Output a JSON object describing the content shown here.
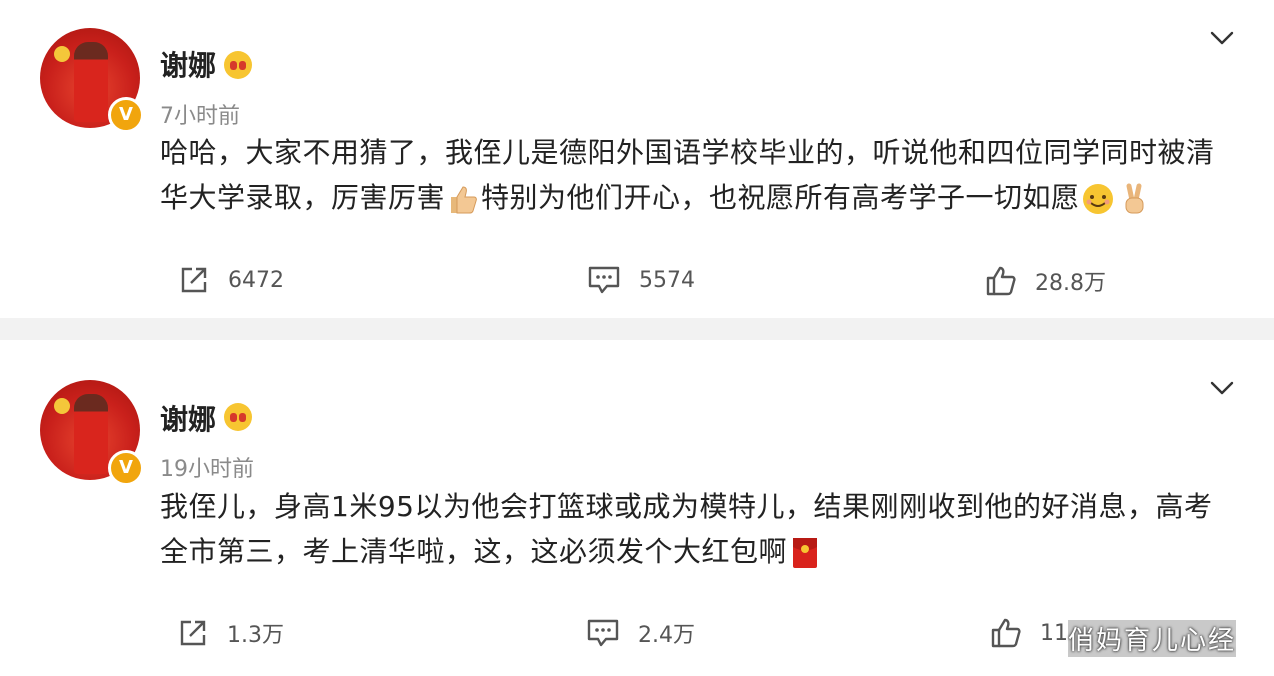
{
  "posts": [
    {
      "username": "谢娜",
      "time": "7小时前",
      "text_part1": "哈哈，大家不用猜了，我侄儿是德阳外国语学校毕业的，听说他和四位同学同时被清华大学录取，厉害厉害",
      "text_part2": "特别为他们开心，也祝愿所有高考学子一切如愿",
      "emojis": [
        "thumbs-up-icon",
        "smile-icon",
        "victory-hand-icon"
      ],
      "reposts": "6472",
      "comments": "5574",
      "likes": "28.8万"
    },
    {
      "username": "谢娜",
      "time": "19小时前",
      "text_part1": "我侄儿，身高1米95以为他会打篮球或成为模特儿，结果刚刚收到他的好消息，高考全市第三，考上清华啦，这，这必须发个大红包啊",
      "emojis": [
        "red-envelope-icon"
      ],
      "reposts": "1.3万",
      "comments": "2.4万",
      "likes": "11"
    }
  ],
  "watermark": "俏妈育儿心经",
  "colors": {
    "verified_badge": "#f1a50d",
    "background": "#f2f2f2",
    "card": "#ffffff",
    "muted_text": "#8a8a8a"
  }
}
